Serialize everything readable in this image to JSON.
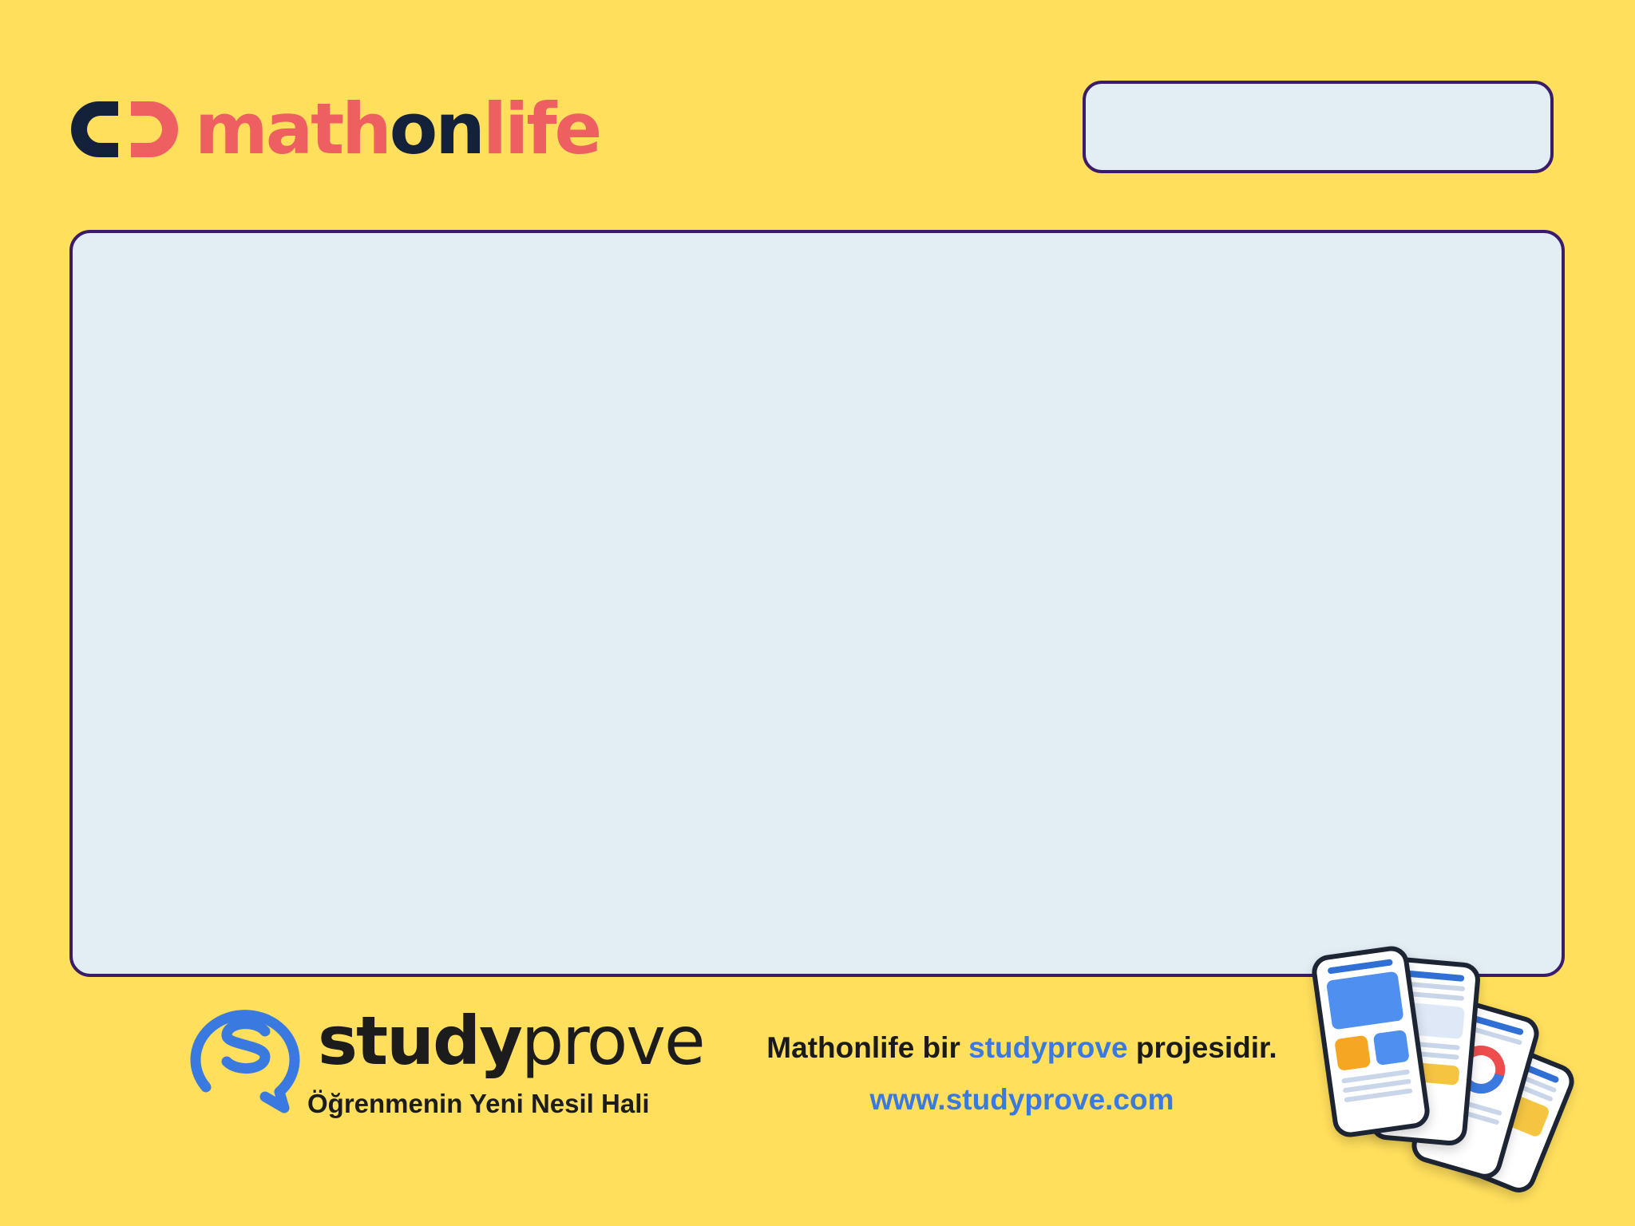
{
  "header": {
    "logo": {
      "icon": "mathonlife-logo-icon",
      "text_parts": [
        "math",
        "on",
        "life"
      ],
      "colors": {
        "math": "#ee5f62",
        "on": "#14213a",
        "life": "#ee5f62"
      }
    },
    "title_box": {
      "value": ""
    }
  },
  "main": {
    "content_box": {
      "value": ""
    }
  },
  "footer": {
    "brand": {
      "icon": "studyprove-logo-icon",
      "name_bold": "study",
      "name_regular": "prove",
      "tagline": "Öğrenmenin Yeni Nesil Hali"
    },
    "project_line": {
      "before": "Mathonlife bir ",
      "highlight": "studyprove",
      "after": " projesidir."
    },
    "website": "www.studyprove.com",
    "phones_illustration": "app-screens-illustration"
  },
  "colors": {
    "background": "#ffdf5c",
    "box_fill": "#e3edf4",
    "box_border": "#3b1b6b",
    "accent_blue": "#3a7ae0",
    "accent_red": "#ee5f62",
    "dark": "#14213a"
  }
}
